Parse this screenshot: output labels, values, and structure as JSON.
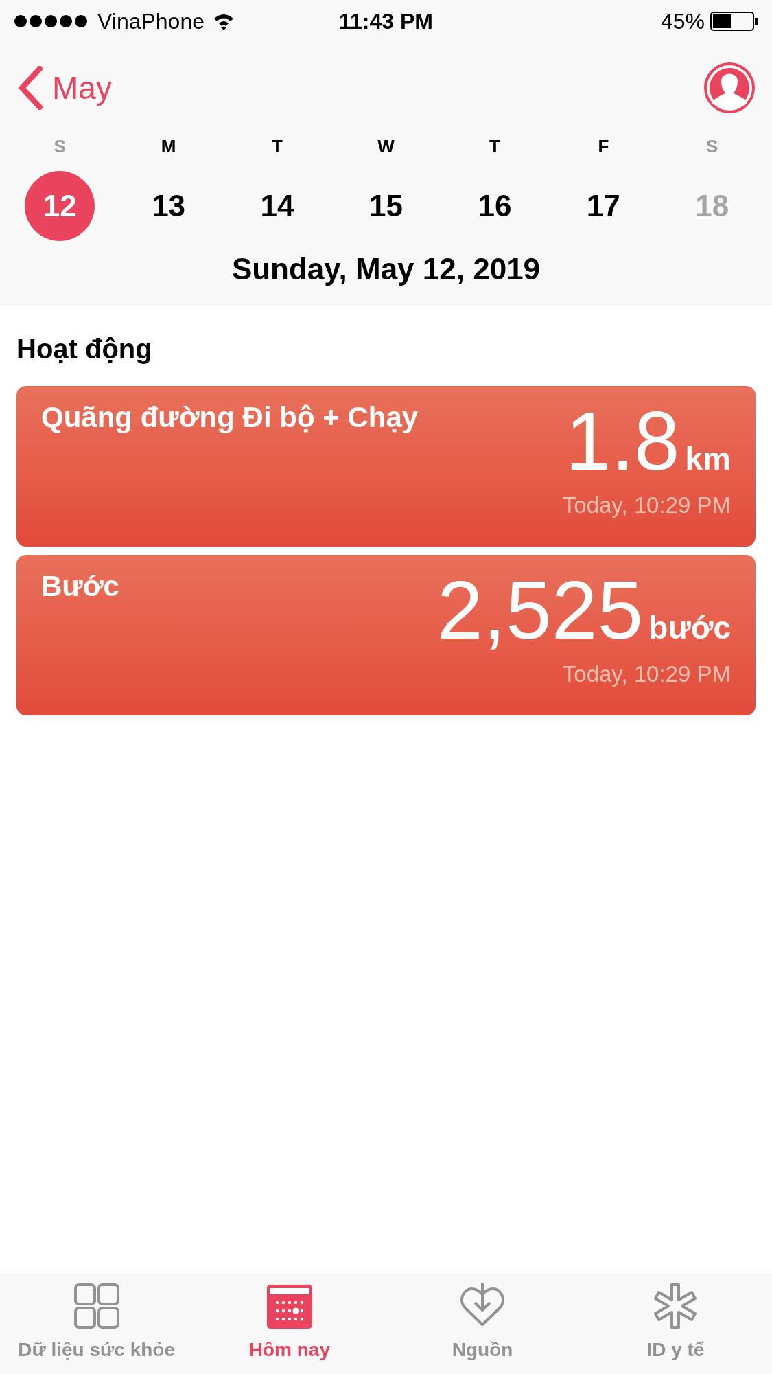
{
  "status_bar": {
    "carrier": "VinaPhone",
    "time": "11:43 PM",
    "battery": "45%"
  },
  "nav": {
    "back": "May"
  },
  "week": [
    {
      "weekday": "S",
      "date": "12",
      "weekend": true,
      "future": false,
      "selected": true
    },
    {
      "weekday": "M",
      "date": "13",
      "weekend": false,
      "future": false,
      "selected": false
    },
    {
      "weekday": "T",
      "date": "14",
      "weekend": false,
      "future": false,
      "selected": false
    },
    {
      "weekday": "W",
      "date": "15",
      "weekend": false,
      "future": false,
      "selected": false
    },
    {
      "weekday": "T",
      "date": "16",
      "weekend": false,
      "future": false,
      "selected": false
    },
    {
      "weekday": "F",
      "date": "17",
      "weekend": false,
      "future": false,
      "selected": false
    },
    {
      "weekday": "S",
      "date": "18",
      "weekend": true,
      "future": true,
      "selected": false
    }
  ],
  "selected_date": "Sunday, May 12, 2019",
  "section": {
    "title": "Hoạt động",
    "cards": [
      {
        "title": "Quãng đường Đi bộ + Chạy",
        "value": "1.8",
        "unit": "km",
        "time": "Today, 10:29 PM"
      },
      {
        "title": "Bước",
        "value": "2,525",
        "unit": "bước",
        "time": "Today, 10:29 PM"
      }
    ]
  },
  "tab_bar": [
    {
      "label": "Dữ liệu sức khỏe",
      "kind": "grid",
      "selected": false
    },
    {
      "label": "Hôm nay",
      "kind": "calendar",
      "selected": true
    },
    {
      "label": "Nguồn",
      "kind": "heart",
      "selected": false
    },
    {
      "label": "ID y tế",
      "kind": "asterisk",
      "selected": false
    }
  ]
}
